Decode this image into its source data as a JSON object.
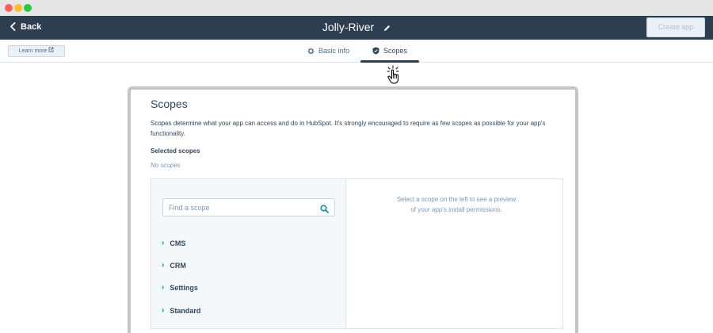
{
  "window": {
    "controls": [
      "close",
      "minimize",
      "zoom"
    ]
  },
  "header": {
    "back_label": "Back",
    "title": "Jolly-River",
    "create_app_label": "Create app"
  },
  "subnav": {
    "learn_more_label": "Learn more",
    "tabs": [
      {
        "label": "Basic info",
        "icon": "gear-icon",
        "selected": false
      },
      {
        "label": "Scopes",
        "icon": "shield-icon",
        "selected": true
      }
    ]
  },
  "scopes": {
    "title": "Scopes",
    "description": "Scopes determine what your app can access and do in HubSpot. It's strongly encouraged to require as few scopes as possible for your app's functionality.",
    "selected_label": "Selected scopes",
    "no_scopes_text": "No scopes",
    "search_placeholder": "Find a scope",
    "categories": [
      "CMS",
      "CRM",
      "Settings",
      "Standard"
    ],
    "preview_text": "Select a scope on the left to see a preview of your app's install permissions."
  },
  "colors": {
    "header_bg": "#2d3e50",
    "accent": "#0091ae",
    "text": "#33475b"
  }
}
